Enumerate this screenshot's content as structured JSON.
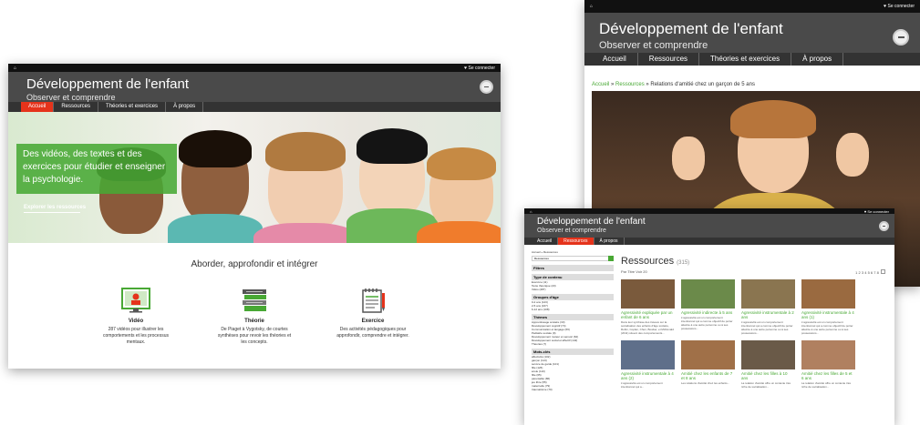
{
  "common": {
    "site_title": "Développement de l'enfant",
    "site_subtitle": "Observer et comprendre",
    "login_label": "Se connecter",
    "nav": [
      "Accueil",
      "Ressources",
      "Théories et exercices",
      "À propos"
    ]
  },
  "home": {
    "active_tab": 0,
    "hero_text": "Des vidéos, des textes et des exercices pour étudier et enseigner la psychologie.",
    "hero_link": "Explorer les ressources",
    "intro": "Aborder, approfondir et intégrer",
    "features": [
      {
        "icon": "video-lesson-icon",
        "title": "Vidéo",
        "desc": "287 vidéos pour illustrer les comportements et les processus mentaux."
      },
      {
        "icon": "books-icon",
        "title": "Théorie",
        "desc": "De Piaget à Vygotsky, de courtes synthèses pour revoir les théories et les concepts."
      },
      {
        "icon": "notepad-icon",
        "title": "Exercice",
        "desc": "Des activités pédagogiques pour approfondir, comprendre et intégrer."
      }
    ]
  },
  "video_page": {
    "breadcrumb": [
      "Accueil",
      "Ressources",
      "Relations d'amitié chez un garçon de 5 ans"
    ],
    "breadcrumb_sep": "»"
  },
  "resources_page": {
    "active_tab": 1,
    "breadcrumb": "Accueil » Ressources",
    "search_placeholder": "Ressources",
    "filter_header": "Filtres",
    "filter_groups": [
      {
        "title": "Type de contenu",
        "items": [
          "Exercice (11)",
          "Texte théorique (23)",
          "Vidéo (287)"
        ]
      },
      {
        "title": "Groupes d'âge",
        "items": [
          "0-2 ans (123)",
          "2-5 ans (167)",
          "6-12 ans (108)"
        ]
      },
      {
        "title": "Thèmes",
        "items": [
          "Apprentissage scolaire (33)",
          "Développement cognitif (74)",
          "Communication et langage (66)",
          "Pédiatrie sociale (9)",
          "Développement moteur et sensori (62)",
          "Développement social et affectif (142)",
          "Théories (7)"
        ]
      },
      {
        "title": "Mots-clés",
        "items": [
          "affectivité (102)",
          "garçon (113)",
          "service de garde (101)",
          "fille (126)",
          "école (110)",
          "fille (65)",
          "parentalité (86)",
          "jeu libre (55)",
          "maternelle (79)",
          "traumatisme (70)"
        ]
      }
    ],
    "title": "Ressources",
    "count": "(315)",
    "sort_label": "Par",
    "sort_value": "Titre",
    "show_label": "Voir",
    "show_value": "20",
    "pager": [
      "1",
      "2",
      "3",
      "4",
      "5",
      "6",
      "7",
      "8"
    ],
    "cards": [
      {
        "title": "Agressivité expliquée par un enfant de 6 ans",
        "desc": "Dans leur synthèse des travaux sur la socialisation des enfants d'âge scolaire, Rubin, Coplan, Chen, Bowker, et McDonald (2011) situent des comportements...",
        "thumb": "#7a5a3c"
      },
      {
        "title": "Agressivité indirecte à 5 ans",
        "desc": "L'agressivité est un comportement intentionnel qui a comme objectif de porter atteinte à une autre personne ou à ses possessions...",
        "thumb": "#6b8a4a"
      },
      {
        "title": "Agressivité instrumentale à 2 ans",
        "desc": "L'agressivité est un comportement intentionnel qui a comme objectif de porter atteinte à une autre personne ou à ses possessions...",
        "thumb": "#8a7550"
      },
      {
        "title": "Agressivité instrumentale à 4 ans (1)",
        "desc": "L'agressivité est un comportement intentionnel qui a comme objectif de porter atteinte à une autre personne ou à ses possessions...",
        "thumb": "#9a6a40"
      },
      {
        "title": "Agressivité instrumentale à 4 ans (2)",
        "desc": "L'agressivité est un comportement intentionnel qui a...",
        "thumb": "#5f6f8a"
      },
      {
        "title": "Amitié chez les enfants de 7 et 8 ans",
        "desc": "Les relations d'amitié chez les enfants...",
        "thumb": "#a07048"
      },
      {
        "title": "Amitié chez les filles à 10 ans",
        "desc": "La relation d'amitié offre un contexte très riche de socialisation...",
        "thumb": "#6a5a48"
      },
      {
        "title": "Amitié chez les filles de 5 et 6 ans",
        "desc": "La relation d'amitié offre un contexte très riche de socialisation...",
        "thumb": "#b08060"
      }
    ]
  }
}
